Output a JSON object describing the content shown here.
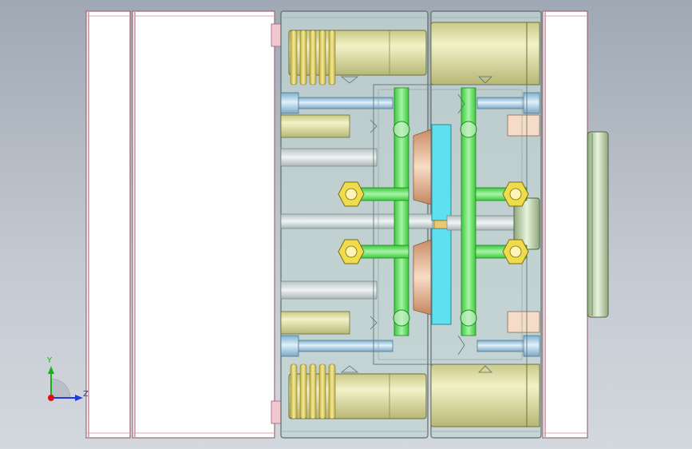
{
  "view": {
    "title": "",
    "axis_triad": {
      "y_label": "Y",
      "z_label": "Z"
    }
  },
  "colors": {
    "background_top": "#9fa8b4",
    "background_bottom": "#d3d8de",
    "plate_fill": "#ffffff",
    "plate_edge": "#b87a86",
    "translucent_plate": "#c4d4d0",
    "guide_pillar": "#e6e6b4",
    "ejector_pin": "#a8d0e4",
    "cooling_channel": "#66e066",
    "cavity_insert": "#5ee0ee",
    "cone_part": "#e4b08c",
    "nut": "#eedc4c",
    "spring": "#d8c85c",
    "locating_ring": "#cfe3c5",
    "axis_y": "#14b414",
    "axis_z": "#1e3cdc",
    "axis_x": "#e01010"
  }
}
